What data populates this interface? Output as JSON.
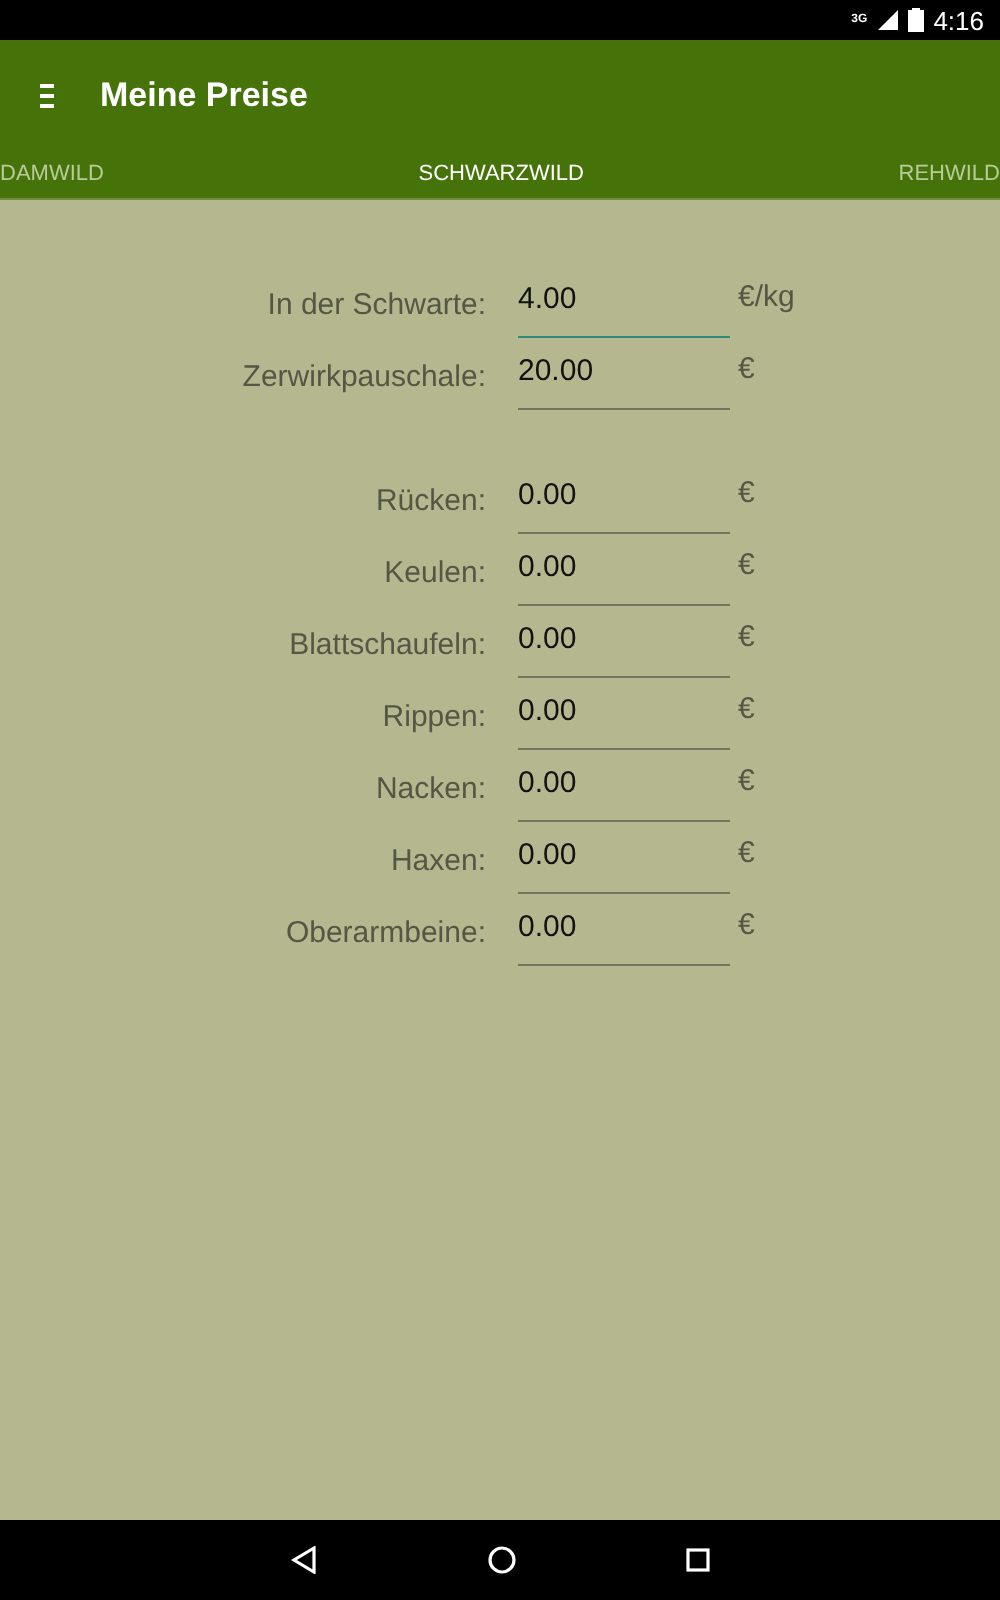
{
  "status_bar": {
    "network": "3G",
    "time": "4:16"
  },
  "app_bar": {
    "title": "Meine Preise"
  },
  "tabs": [
    {
      "label": "DAMWILD",
      "selected": false
    },
    {
      "label": "SCHWARZWILD",
      "selected": true
    },
    {
      "label": "REHWILD",
      "selected": false
    }
  ],
  "groups": [
    {
      "fields": [
        {
          "label": "In der Schwarte:",
          "value": "4.00",
          "unit": "€/kg",
          "focused": true
        },
        {
          "label": "Zerwirkpauschale:",
          "value": "20.00",
          "unit": "€",
          "focused": false
        }
      ]
    },
    {
      "fields": [
        {
          "label": "Rücken:",
          "value": "0.00",
          "unit": "€",
          "focused": false
        },
        {
          "label": "Keulen:",
          "value": "0.00",
          "unit": "€",
          "focused": false
        },
        {
          "label": "Blattschaufeln:",
          "value": "0.00",
          "unit": "€",
          "focused": false
        },
        {
          "label": "Rippen:",
          "value": "0.00",
          "unit": "€",
          "focused": false
        },
        {
          "label": "Nacken:",
          "value": "0.00",
          "unit": "€",
          "focused": false
        },
        {
          "label": "Haxen:",
          "value": "0.00",
          "unit": "€",
          "focused": false
        },
        {
          "label": "Oberarmbeine:",
          "value": "0.00",
          "unit": "€",
          "focused": false
        }
      ]
    }
  ]
}
